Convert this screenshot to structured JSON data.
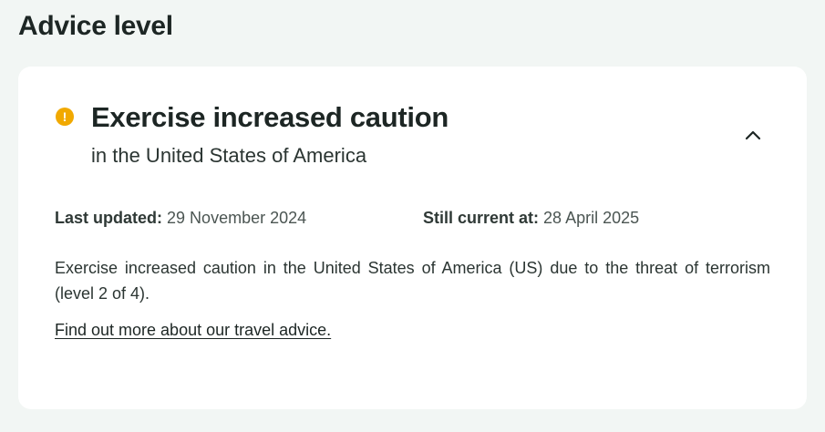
{
  "section": {
    "title": "Advice level"
  },
  "advice": {
    "icon": "exclamation-circle-icon",
    "icon_glyph": "!",
    "icon_color": "#f1a900",
    "heading": "Exercise increased caution",
    "location": "in the United States of America",
    "toggle_icon": "chevron-up-icon",
    "last_updated_label": "Last updated:",
    "last_updated_value": "29 November 2024",
    "still_current_label": "Still current at:",
    "still_current_value": "28 April 2025",
    "body": "Exercise increased caution in the United States of America (US) due to the threat of terrorism (level 2 of 4).",
    "link_text": "Find out more about our travel advice."
  }
}
